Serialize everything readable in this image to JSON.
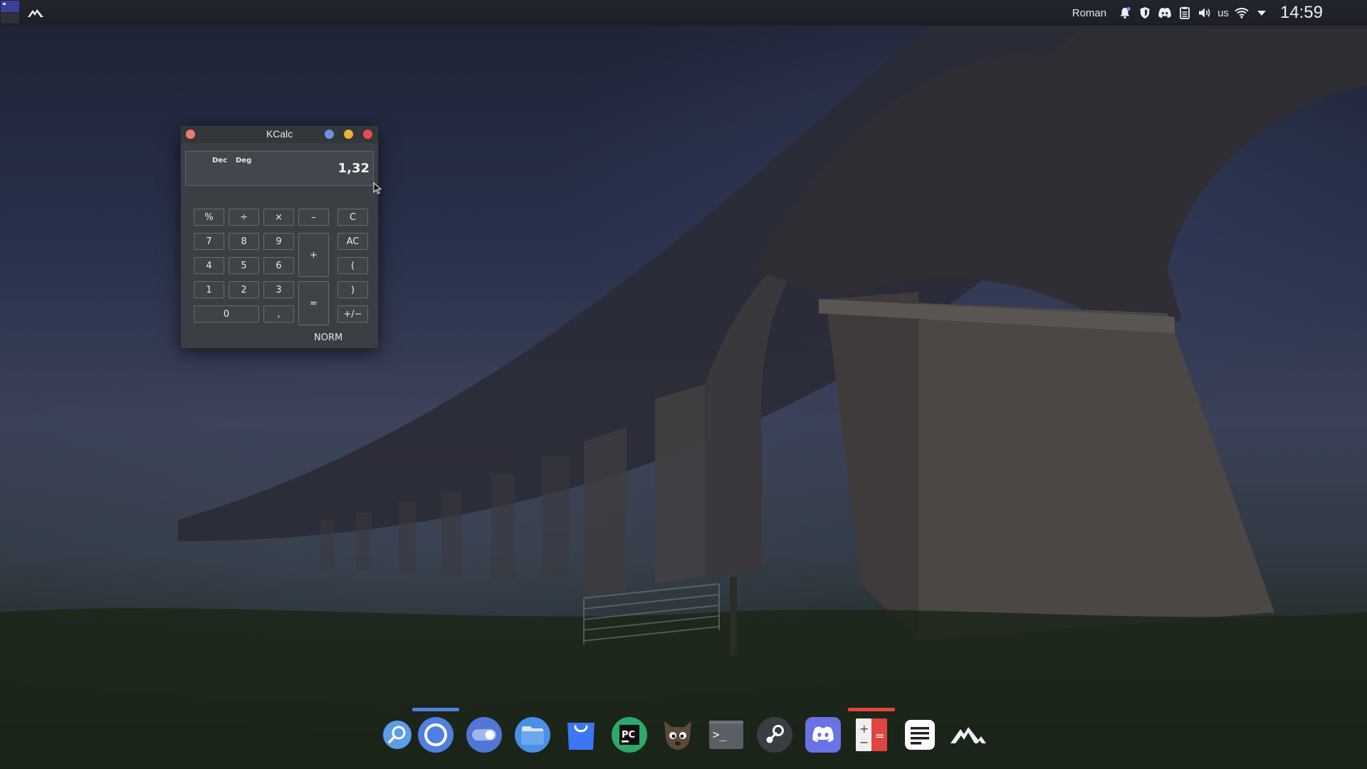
{
  "panel": {
    "user": "Roman",
    "keyboard_layout": "us",
    "clock": "14:59",
    "tray_icons": [
      "notification-bell-icon",
      "shield-icon",
      "discord-tray-icon",
      "clipboard-icon",
      "volume-icon",
      "wifi-icon",
      "tray-expand-icon"
    ]
  },
  "kcalc": {
    "title": "KCalc",
    "display": {
      "base_mode": "Dec",
      "angle_mode": "Deg",
      "value": "1,32"
    },
    "status": "NORM",
    "buttons": {
      "percent": "%",
      "divide": "÷",
      "multiply": "×",
      "minus": "–",
      "clear": "C",
      "seven": "7",
      "eight": "8",
      "nine": "9",
      "plus": "+",
      "all_clear": "AC",
      "four": "4",
      "five": "5",
      "six": "6",
      "paren_open": "(",
      "one": "1",
      "two": "2",
      "three": "3",
      "equals": "=",
      "paren_close": ")",
      "zero": "0",
      "comma": ",",
      "sign": "+/−"
    }
  },
  "dock": {
    "items": [
      "search-app-icon",
      "chromium-icon",
      "settings-toggle-icon",
      "files-folder-icon",
      "software-store-icon",
      "pycharm-icon",
      "gimp-icon",
      "terminal-icon",
      "steam-icon",
      "discord-icon",
      "kcalc-icon",
      "text-editor-icon",
      "launcher-mountain-icon"
    ],
    "pycharm_label": "PC",
    "terminal_label": ">_",
    "calc_plus": "+",
    "calc_minus": "−",
    "calc_equals": "="
  },
  "colors": {
    "accent_active": "#4f7fe0",
    "calc_active": "#e0453f"
  }
}
